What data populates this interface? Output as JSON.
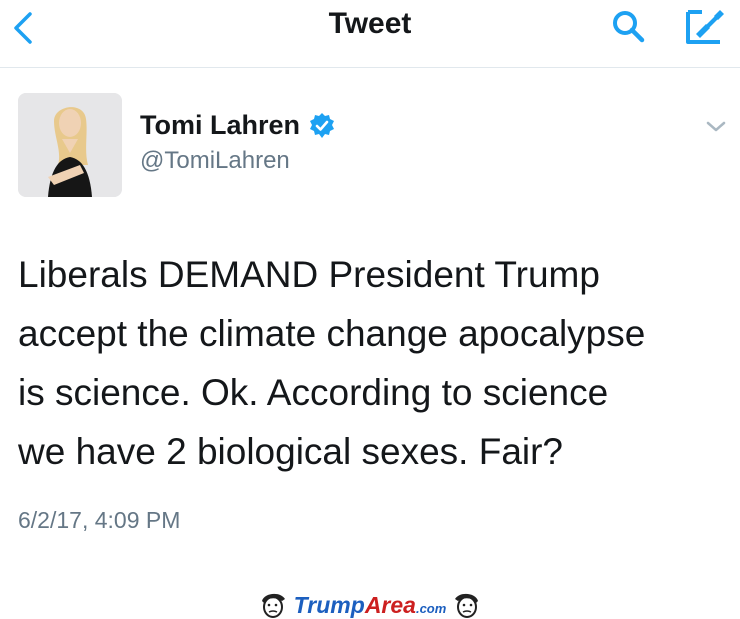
{
  "nav": {
    "title": "Tweet",
    "back_icon": "chevron-left-icon",
    "search_icon": "search-icon",
    "compose_icon": "compose-icon"
  },
  "tweet": {
    "author_name": "Tomi Lahren",
    "handle": "@TomiLahren",
    "verified": true,
    "text_lines": [
      "Liberals DEMAND President Trump",
      "accept the climate change apocalypse",
      "is science. Ok. According to science",
      "we have 2 biological sexes. Fair?"
    ],
    "timestamp": "6/2/17, 4:09 PM"
  },
  "watermark": {
    "part1": "Trump",
    "part2": "Area",
    "part3": ".com"
  },
  "colors": {
    "accent": "#1da1f2",
    "text": "#14171a",
    "muted": "#657786",
    "divider": "#e1e8ed"
  }
}
